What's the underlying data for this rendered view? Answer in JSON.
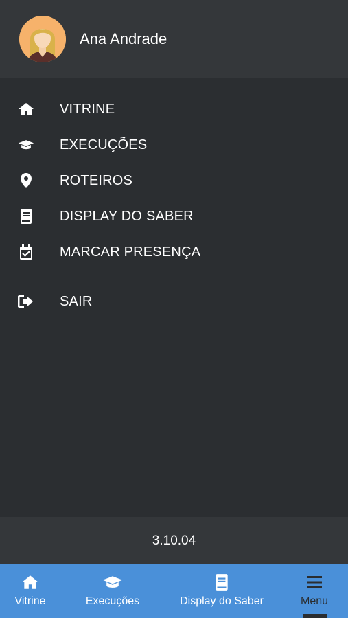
{
  "user": {
    "name": "Ana Andrade"
  },
  "menu": {
    "items": [
      {
        "label": "VITRINE",
        "icon": "home-icon"
      },
      {
        "label": "EXECUÇÕES",
        "icon": "graduation-cap-icon"
      },
      {
        "label": "ROTEIROS",
        "icon": "map-pin-icon"
      },
      {
        "label": "DISPLAY DO SABER",
        "icon": "book-icon"
      },
      {
        "label": "MARCAR PRESENÇA",
        "icon": "calendar-check-icon"
      },
      {
        "label": "SAIR",
        "icon": "sign-out-icon"
      }
    ]
  },
  "version": "3.10.04",
  "tabs": [
    {
      "label": "Vitrine",
      "icon": "home-icon"
    },
    {
      "label": "Execuções",
      "icon": "graduation-cap-icon"
    },
    {
      "label": "Display do Saber",
      "icon": "book-icon"
    },
    {
      "label": "Menu",
      "icon": "hamburger-menu-icon",
      "active": true
    }
  ],
  "colors": {
    "drawer_bg": "#2b2e31",
    "header_bg": "#34373a",
    "tabbar_bg": "#4a90d9",
    "active_tab": "#2a2d30",
    "avatar_bg": "#f6b26b"
  }
}
